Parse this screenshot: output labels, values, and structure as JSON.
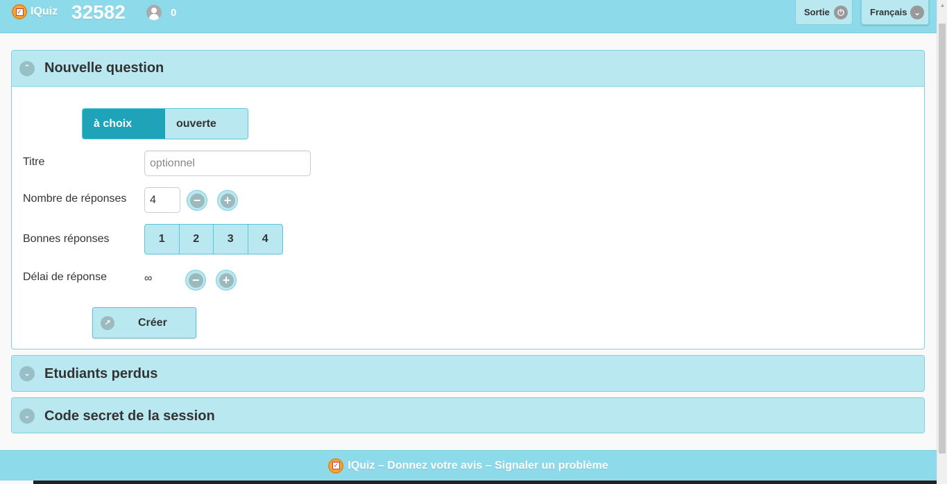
{
  "header": {
    "app_name": "IQuiz",
    "session_number": "32582",
    "user_count": "0",
    "exit_label": "Sortie",
    "language_label": "Français"
  },
  "panels": [
    {
      "title": "Nouvelle question",
      "expanded": true
    },
    {
      "title": "Etudiants perdus",
      "expanded": false
    },
    {
      "title": "Code secret de la session",
      "expanded": false
    }
  ],
  "question_form": {
    "type_options": [
      "à choix",
      "ouverte"
    ],
    "selected_type": "à choix",
    "title_label": "Titre",
    "title_placeholder": "optionnel",
    "title_value": "",
    "answer_count_label": "Nombre de réponses",
    "answer_count_value": "4",
    "correct_answers_label": "Bonnes réponses",
    "correct_answer_options": [
      "1",
      "2",
      "3",
      "4"
    ],
    "delay_label": "Délai de réponse",
    "delay_value": "∞",
    "create_label": "Créer"
  },
  "footer": {
    "text": "IQuiz – Donnez votre avis – Signaler un problème"
  },
  "icons": [
    "logo-icon",
    "user-icon",
    "power-icon",
    "chevron-down-icon",
    "chevron-up-icon",
    "minus-icon",
    "plus-icon",
    "share-icon"
  ],
  "colors": {
    "header_bg": "#8ddbea",
    "panel_bg": "#b9e8f0",
    "accent": "#1fa3b9",
    "border": "#7fcfdf"
  }
}
